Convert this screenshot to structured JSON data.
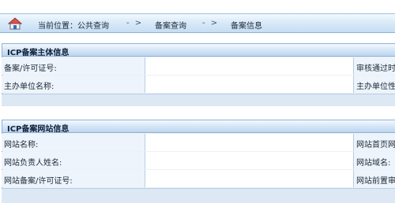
{
  "breadcrumb": {
    "prefix": "当前位置：",
    "items": [
      "公共查询",
      "备案查询",
      "备案信息"
    ],
    "separator": "- >"
  },
  "sections": [
    {
      "title": "ICP备案主体信息",
      "rows": [
        {
          "label": "备案/许可证号:",
          "right_label": "审核通过时间"
        },
        {
          "label": "主办单位名称:",
          "right_label": "主办单位性质"
        }
      ]
    },
    {
      "title": "ICP备案网站信息",
      "rows": [
        {
          "label": "网站名称:",
          "right_label": "网站首页网址"
        },
        {
          "label": "网站负责人姓名:",
          "right_label": "网站域名:"
        },
        {
          "label": "网站备案/许可证号:",
          "right_label": "网站前置审批"
        }
      ]
    }
  ],
  "colors": {
    "topbar": "#d9eaf8",
    "section_header": "#d3e4f5",
    "label_cell": "#eef4fb",
    "border": "#8fb0d4"
  },
  "icons": {
    "home": "home-icon"
  }
}
